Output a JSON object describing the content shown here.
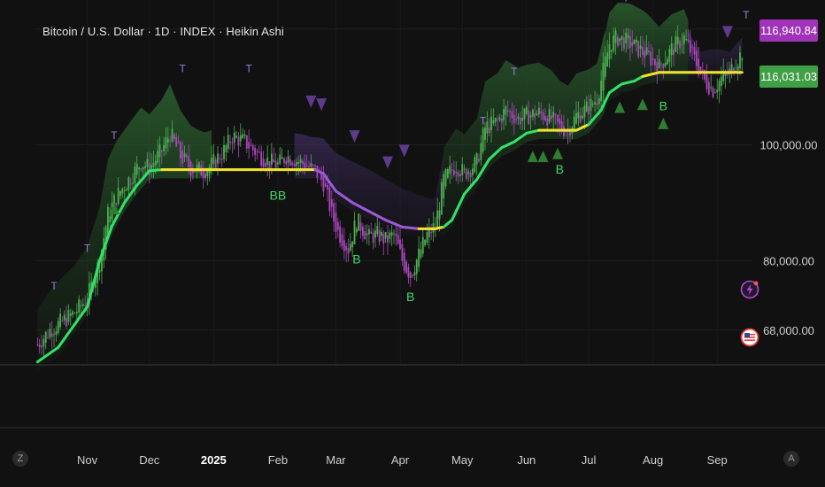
{
  "header": {
    "title": "Bitcoin / U.S. Dollar · 1D · INDEX · Heikin Ashi"
  },
  "price_labels": {
    "upper": "116,940.84",
    "lower": "116,031.03",
    "upper_color": "#a033b8",
    "lower_color": "#3f9f45"
  },
  "axis_buttons": {
    "left": "Z",
    "right": "A"
  },
  "icons": {
    "lightning": "lightning-icon",
    "flag": "us-flag-icon"
  },
  "colors": {
    "background": "#111111",
    "bull_candle": "#4caf50",
    "bear_candle": "#ab47bc",
    "trend_bull": "#33e06a",
    "trend_bear": "#9b59d6",
    "trend_flat": "#f2e230",
    "marker_bull": "#2e7d32",
    "marker_bear": "#5e3a8c",
    "label_t": "#9b7bd8",
    "label_b": "#3ddc6a"
  },
  "chart_data": {
    "type": "candlestick",
    "title": "Bitcoin / U.S. Dollar · 1D · INDEX · Heikin Ashi",
    "y_ticks": [
      {
        "value": 100000,
        "label": "100,000.00"
      },
      {
        "value": 80000,
        "label": "80,000.00"
      },
      {
        "value": 68000,
        "label": "68,000.00"
      }
    ],
    "ylim": [
      62000,
      125000
    ],
    "x_ticks": [
      {
        "day": 0,
        "label": "Nov"
      },
      {
        "day": 30,
        "label": "Dec"
      },
      {
        "day": 61,
        "label": "2025",
        "bold": true
      },
      {
        "day": 92,
        "label": "Feb"
      },
      {
        "day": 120,
        "label": "Mar"
      },
      {
        "day": 151,
        "label": "Apr"
      },
      {
        "day": 181,
        "label": "May"
      },
      {
        "day": 212,
        "label": "Jun"
      },
      {
        "day": 242,
        "label": "Jul"
      },
      {
        "day": 273,
        "label": "Aug"
      },
      {
        "day": 304,
        "label": "Sep"
      }
    ],
    "xlim": [
      -25,
      321
    ],
    "price_path": [
      [
        -24,
        65500
      ],
      [
        -18,
        68000
      ],
      [
        -12,
        69500
      ],
      [
        -6,
        71000
      ],
      [
        0,
        73500
      ],
      [
        6,
        80000
      ],
      [
        10,
        88000
      ],
      [
        14,
        91000
      ],
      [
        20,
        94000
      ],
      [
        26,
        97000
      ],
      [
        30,
        96000
      ],
      [
        36,
        99000
      ],
      [
        40,
        102000
      ],
      [
        45,
        98000
      ],
      [
        50,
        96000
      ],
      [
        56,
        95500
      ],
      [
        60,
        96500
      ],
      [
        66,
        99000
      ],
      [
        70,
        101500
      ],
      [
        76,
        100500
      ],
      [
        82,
        98500
      ],
      [
        88,
        97000
      ],
      [
        92,
        96500
      ],
      [
        96,
        98000
      ],
      [
        100,
        97500
      ],
      [
        104,
        96800
      ],
      [
        110,
        95500
      ],
      [
        114,
        93500
      ],
      [
        118,
        88000
      ],
      [
        121,
        85000
      ],
      [
        126,
        82000
      ],
      [
        130,
        87000
      ],
      [
        136,
        84000
      ],
      [
        140,
        84500
      ],
      [
        144,
        83500
      ],
      [
        148,
        84500
      ],
      [
        152,
        80000
      ],
      [
        156,
        77500
      ],
      [
        160,
        81000
      ],
      [
        164,
        84500
      ],
      [
        168,
        86000
      ],
      [
        172,
        94000
      ],
      [
        178,
        96500
      ],
      [
        182,
        95000
      ],
      [
        188,
        97000
      ],
      [
        192,
        103000
      ],
      [
        198,
        104000
      ],
      [
        202,
        106000
      ],
      [
        208,
        104500
      ],
      [
        212,
        105000
      ],
      [
        218,
        105500
      ],
      [
        224,
        104500
      ],
      [
        228,
        103000
      ],
      [
        232,
        102500
      ],
      [
        236,
        105000
      ],
      [
        242,
        106500
      ],
      [
        246,
        108000
      ],
      [
        252,
        117500
      ],
      [
        256,
        118500
      ],
      [
        262,
        117500
      ],
      [
        266,
        116500
      ],
      [
        270,
        115500
      ],
      [
        276,
        113500
      ],
      [
        282,
        116500
      ],
      [
        288,
        118500
      ],
      [
        294,
        114000
      ],
      [
        298,
        111000
      ],
      [
        302,
        109500
      ],
      [
        306,
        111500
      ],
      [
        310,
        112500
      ],
      [
        316,
        116000
      ]
    ],
    "trend_line": [
      [
        -24,
        62500
      ],
      [
        -14,
        65000
      ],
      [
        -6,
        69000
      ],
      [
        0,
        72000
      ],
      [
        6,
        80000
      ],
      [
        12,
        86000
      ],
      [
        18,
        90000
      ],
      [
        24,
        93000
      ],
      [
        30,
        95500
      ],
      [
        36,
        95700
      ],
      [
        60,
        95700
      ],
      [
        70,
        95700
      ],
      [
        100,
        95700
      ],
      [
        110,
        95700
      ],
      [
        114,
        95000
      ],
      [
        120,
        92000
      ],
      [
        128,
        90000
      ],
      [
        136,
        88500
      ],
      [
        144,
        87000
      ],
      [
        152,
        85800
      ],
      [
        160,
        85500
      ],
      [
        168,
        85500
      ],
      [
        172,
        85800
      ],
      [
        176,
        87000
      ],
      [
        182,
        91500
      ],
      [
        188,
        94000
      ],
      [
        194,
        97500
      ],
      [
        200,
        99500
      ],
      [
        206,
        100500
      ],
      [
        212,
        102000
      ],
      [
        218,
        102500
      ],
      [
        236,
        102500
      ],
      [
        242,
        103500
      ],
      [
        248,
        106000
      ],
      [
        252,
        109000
      ],
      [
        258,
        110500
      ],
      [
        264,
        111000
      ],
      [
        268,
        111800
      ],
      [
        276,
        112500
      ],
      [
        312,
        112500
      ],
      [
        316,
        112500
      ]
    ],
    "trend_segments": [
      {
        "from": -24,
        "to": 36,
        "state": "bull"
      },
      {
        "from": 36,
        "to": 110,
        "state": "flat"
      },
      {
        "from": 110,
        "to": 160,
        "state": "bear"
      },
      {
        "from": 160,
        "to": 172,
        "state": "flat"
      },
      {
        "from": 172,
        "to": 218,
        "state": "bull"
      },
      {
        "from": 218,
        "to": 242,
        "state": "flat"
      },
      {
        "from": 242,
        "to": 268,
        "state": "bull"
      },
      {
        "from": 268,
        "to": 316,
        "state": "flat"
      }
    ],
    "t_labels": [
      {
        "day": -16,
        "price": 75000,
        "text": "T"
      },
      {
        "day": 0,
        "price": 81500,
        "text": "T"
      },
      {
        "day": 13,
        "price": 101000,
        "text": "T"
      },
      {
        "day": 46,
        "price": 112500,
        "text": "T"
      },
      {
        "day": 78,
        "price": 112500,
        "text": "T"
      },
      {
        "day": 191,
        "price": 103500,
        "text": "T"
      },
      {
        "day": 206,
        "price": 112000,
        "text": "T"
      },
      {
        "day": 260,
        "price": 124800,
        "text": "T"
      },
      {
        "day": 293,
        "price": 125500,
        "text": "T"
      },
      {
        "day": 318,
        "price": 121800,
        "text": "T"
      }
    ],
    "b_labels": [
      {
        "day": 92,
        "price": 90500,
        "text": "BB"
      },
      {
        "day": 130,
        "price": 79500,
        "text": "B"
      },
      {
        "day": 156,
        "price": 73000,
        "text": "B"
      },
      {
        "day": 228,
        "price": 95000,
        "text": "B"
      },
      {
        "day": 278,
        "price": 106000,
        "text": "B"
      }
    ],
    "bear_triangles": [
      {
        "day": 108,
        "price": 108500
      },
      {
        "day": 113,
        "price": 108000
      },
      {
        "day": 129,
        "price": 102500
      },
      {
        "day": 145,
        "price": 98000
      },
      {
        "day": 153,
        "price": 100000
      },
      {
        "day": 309,
        "price": 120500
      }
    ],
    "bull_triangles": [
      {
        "day": 13,
        "price": 88000
      },
      {
        "day": 215,
        "price": 97000
      },
      {
        "day": 220,
        "price": 97000
      },
      {
        "day": 227,
        "price": 97500
      },
      {
        "day": 257,
        "price": 105500
      },
      {
        "day": 268,
        "price": 106000
      },
      {
        "day": 278,
        "price": 102700
      }
    ]
  }
}
